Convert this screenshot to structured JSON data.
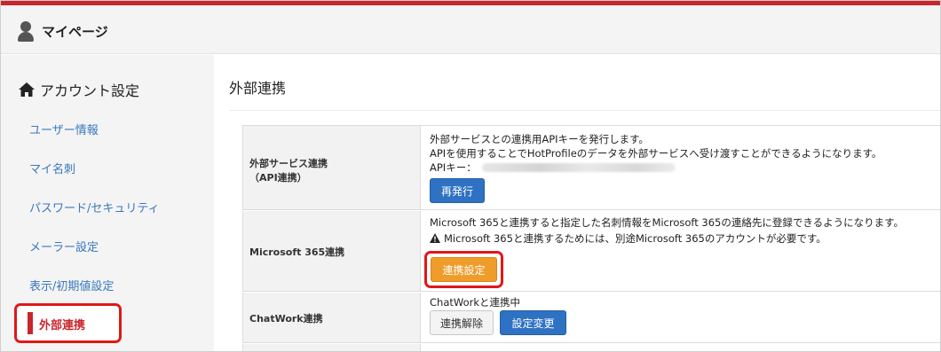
{
  "header": {
    "title": "マイページ"
  },
  "sidebar": {
    "section_label": "アカウント設定",
    "items": [
      {
        "label": "ユーザー情報"
      },
      {
        "label": "マイ名刺"
      },
      {
        "label": "パスワード/セキュリティ"
      },
      {
        "label": "メーラー設定"
      },
      {
        "label": "表示/初期値設定"
      },
      {
        "label": "外部連携",
        "active": true
      }
    ]
  },
  "main": {
    "title": "外部連携",
    "rows": [
      {
        "header_line1": "外部サービス連携",
        "header_line2": "（API連携）",
        "desc1": "外部サービスとの連携用APIキーを発行します。",
        "desc2": "APIを使用することでHotProfileのデータを外部サービスへ受け渡すことができるようになります。",
        "api_key_label": "APIキー：",
        "button": "再発行"
      },
      {
        "header": "Microsoft 365連携",
        "desc1": "Microsoft 365と連携すると指定した名刺情報をMicrosoft 365の連絡先に登録できるようになります。",
        "warning": "Microsoft 365と連携するためには、別途Microsoft 365のアカウントが必要です。",
        "button": "連携設定"
      },
      {
        "header": "ChatWork連携",
        "status": "ChatWorkと連携中",
        "button_release": "連携解除",
        "button_change": "設定変更"
      }
    ]
  },
  "colors": {
    "brand_red": "#c9252c",
    "link_blue": "#3a78bd",
    "button_blue": "#2f72c3",
    "button_orange": "#ef9d2a",
    "highlight_red": "#e01818"
  },
  "icons": {
    "user": "user-icon",
    "home": "home-icon",
    "warning": "warning-icon"
  }
}
